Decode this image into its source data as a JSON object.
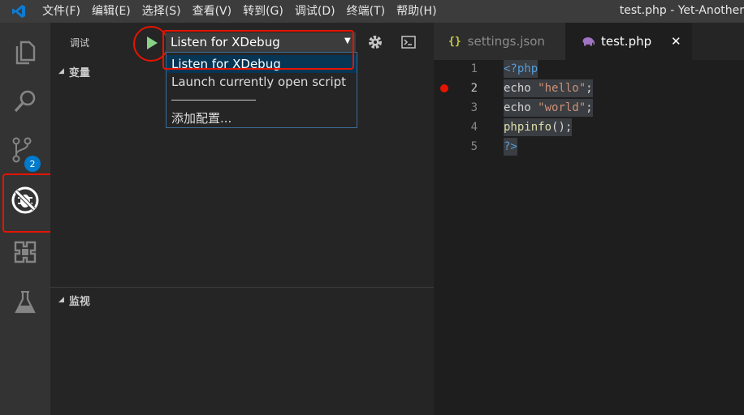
{
  "window_title": "test.php - Yet-Another",
  "menu": [
    "文件(F)",
    "编辑(E)",
    "选择(S)",
    "查看(V)",
    "转到(G)",
    "调试(D)",
    "终端(T)",
    "帮助(H)"
  ],
  "activity_bar": {
    "scm_badge": "2"
  },
  "debug": {
    "title": "调试",
    "selected_config": "Listen for XDebug",
    "dropdown": {
      "options": [
        "Listen for XDebug",
        "Launch currently open script"
      ],
      "separator": "──────────",
      "add_config": "添加配置..."
    },
    "sections": {
      "variables": "变量",
      "watch": "监视"
    }
  },
  "editor": {
    "tabs": [
      {
        "label": "settings.json",
        "icon": "json-file-icon",
        "active": false
      },
      {
        "label": "test.php",
        "icon": "php-elephant-icon",
        "active": true
      }
    ],
    "close_glyph": "✕",
    "line_numbers": [
      "1",
      "2",
      "3",
      "4",
      "5"
    ],
    "breakpoint_line": 2,
    "code": {
      "l1": "<?php",
      "l2_kw": "echo ",
      "l2_str": "\"hello\"",
      "l2_end": ";",
      "l3_kw": "echo ",
      "l3_str": "\"world\"",
      "l3_end": ";",
      "l4_fn": "phpinfo",
      "l4_end": "();",
      "l5": "?>"
    }
  },
  "colors": {
    "accent": "#007acc",
    "annotation_red": "#e51400",
    "breakpoint": "#e51400"
  }
}
